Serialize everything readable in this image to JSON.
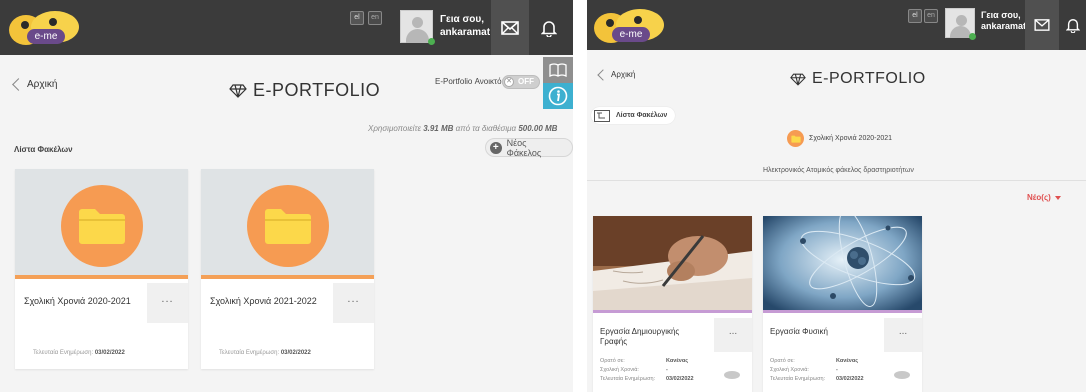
{
  "brand": {
    "logo_text": "e-me",
    "colors": {
      "topbar": "#3b3b3b",
      "accent_orange": "#f69b52",
      "info_blue": "#3db0d0"
    }
  },
  "lang": {
    "el": "el",
    "en": "en"
  },
  "user": {
    "greeting_line1": "Γεια σου,",
    "greeting_line2": "ankaramat"
  },
  "icons": {
    "mail": "mail-icon",
    "bell": "bell-icon",
    "book": "book-icon",
    "info": "info-icon",
    "folder": "folder-icon",
    "diamond": "diamond-icon"
  },
  "left": {
    "back_label": "Αρχική",
    "title": "E-PORTFOLIO",
    "toggle_label": "E-Portfolio Ανοικτό:",
    "toggle_state": "OFF",
    "toggle_x": "✕",
    "storage": {
      "prefix": "Χρησιμοποιείτε ",
      "used": "3.91 MB",
      "middle": " από τα διαθέσιμα ",
      "total": "500.00 MB"
    },
    "section_label": "Λίστα Φακέλων",
    "new_folder_label": "Νέος Φάκελος",
    "folders": [
      {
        "name": "Σχολική Χρονιά 2020-2021",
        "updated_label": "Τελευταία Ενημέρωση: ",
        "updated_value": "03/02/2022",
        "more": "..."
      },
      {
        "name": "Σχολική Χρονιά 2021-2022",
        "updated_label": "Τελευταία Ενημέρωση: ",
        "updated_value": "03/02/2022",
        "more": "..."
      }
    ]
  },
  "right": {
    "back_label": "Αρχική",
    "title": "E-PORTFOLIO",
    "crumb_label": "Λίστα Φακέλων",
    "current_folder": "Σχολική Χρονιά 2020-2021",
    "caption": "Ηλεκτρονικός Ατομικός φάκελος δραστηριοτήτων",
    "new_label": "Νέο(ς)",
    "items": [
      {
        "title": "Εργασία Δημιουργικής Γραφής",
        "visible_label": "Ορατό σε:",
        "visible_value": "Κανένας",
        "year_label": "Σχολική Χρονιά:",
        "year_value": "-",
        "updated_label": "Τελευταία Ενημέρωση:",
        "updated_value": "03/02/2022",
        "more": "..."
      },
      {
        "title": "Εργασία Φυσική",
        "visible_label": "Ορατό σε:",
        "visible_value": "Κανένας",
        "year_label": "Σχολική Χρονιά:",
        "year_value": "-",
        "updated_label": "Τελευταία Ενημέρωση:",
        "updated_value": "03/02/2022",
        "more": "..."
      }
    ]
  }
}
